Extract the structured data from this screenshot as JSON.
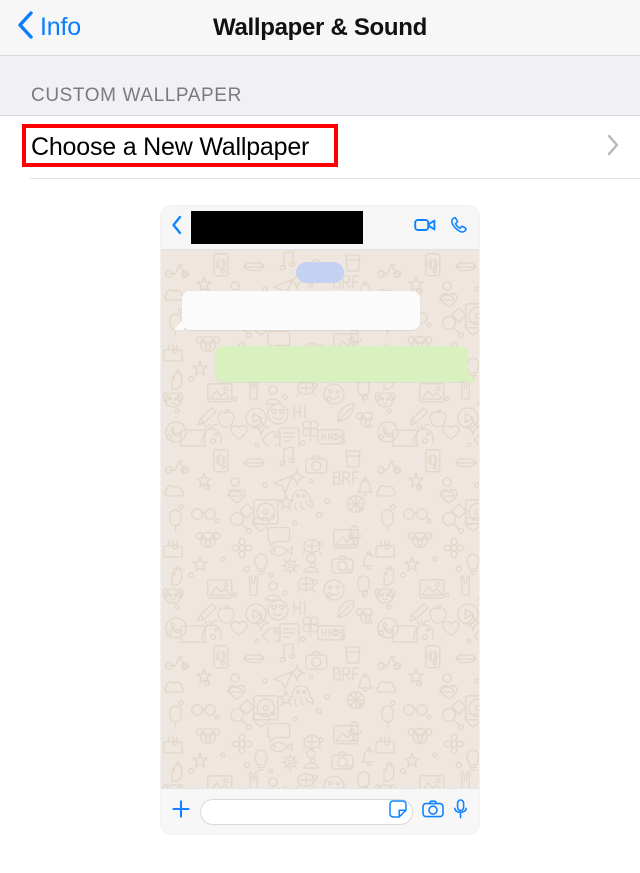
{
  "navbar": {
    "back_label": "Info",
    "title": "Wallpaper & Sound",
    "back_icon": "chevron-left-icon",
    "accent_color": "#0A7CFF"
  },
  "section": {
    "header": "CUSTOM WALLPAPER"
  },
  "row": {
    "label": "Choose a New Wallpaper",
    "disclosure_icon": "chevron-right-icon",
    "highlighted": true,
    "highlight_color": "#FF0000"
  },
  "preview": {
    "topbar": {
      "back_icon": "chevron-left-icon",
      "contact_name": "",
      "contact_name_redacted": true,
      "video_call_icon": "video-camera-icon",
      "voice_call_icon": "phone-icon"
    },
    "wallpaper": {
      "name": "whatsapp-doodle-beige",
      "base_color": "#EFE7DF",
      "doodle_color": "#E0D6C9"
    },
    "chat": {
      "date_pill_color": "#C3D1F2",
      "incoming_bubble_color": "#FBFBFB",
      "outgoing_bubble_color": "#D9F1BE"
    },
    "inputbar": {
      "plus_icon": "plus-icon",
      "placeholder": "",
      "sticker_icon": "sticker-icon",
      "camera_icon": "camera-icon",
      "mic_icon": "microphone-icon"
    }
  }
}
